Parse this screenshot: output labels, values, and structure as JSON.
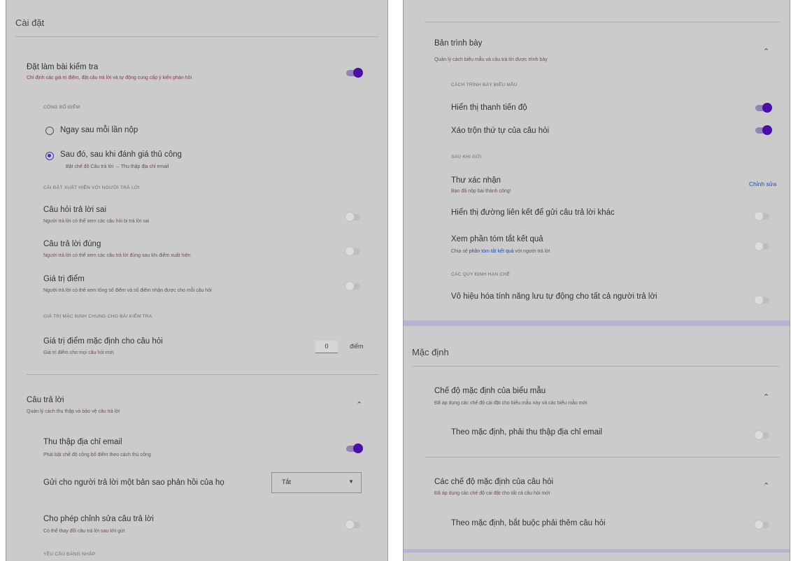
{
  "left": {
    "title": "Cài đặt",
    "quiz": {
      "label": "Đặt làm bài kiểm tra",
      "desc": "Chỉ định các giá trị điểm, đặt câu trả lời và tự động cung cấp ý kiến phản hồi",
      "toggle": true
    },
    "release_caption": "CÔNG BỐ ĐIỂM",
    "release_options": [
      {
        "label": "Ngay sau mỗi lần nộp",
        "selected": false
      },
      {
        "label": "Sau đó, sau khi đánh giá thủ công",
        "selected": true,
        "sub": "Bật chế độ Câu trả lời → Thu thập địa chỉ email"
      }
    ],
    "see_caption": "CÀI ĐẶT XUẤT HIỆN VỚI NGƯỜI TRẢ LỜI",
    "see_items": [
      {
        "label": "Câu hỏi trả lời sai",
        "desc": "Người trả lời có thể xem các câu hỏi bị trả lời sai",
        "toggle": false
      },
      {
        "label": "Câu trả lời đúng",
        "desc": "Người trả lời có thể xem các câu trả lời đúng sau khi điểm xuất hiện",
        "toggle": false
      },
      {
        "label": "Giá trị điểm",
        "desc": "Người trả lời có thể xem tổng số điểm và số điểm nhận được cho mỗi câu hỏi",
        "toggle": false
      }
    ],
    "default_caption": "GIÁ TRỊ MẶC ĐỊNH CHUNG CHO BÀI KIỂM TRA",
    "default_points": {
      "label": "Giá trị điểm mặc định cho câu hỏi",
      "desc": "Giá trị điểm cho mọi câu hỏi mới",
      "value": "0",
      "unit": "điểm"
    },
    "responses": {
      "label": "Câu trả lời",
      "desc": "Quản lý cách thu thập và bảo vệ câu trả lời",
      "chevron": "⌃"
    },
    "collect_email": {
      "label": "Thu thập địa chỉ email",
      "desc": "Phải bật chế độ công bố điểm theo cách thủ công",
      "toggle": true
    },
    "send_copy": {
      "label": "Gửi cho người trả lời một bản sao phản hồi của họ",
      "select_value": "Tắt",
      "arrow": "▼"
    },
    "allow_edit": {
      "label": "Cho phép chỉnh sửa câu trả lời",
      "desc": "Có thể thay đổi câu trả lời sau khi gửi",
      "toggle": false
    },
    "login_caption": "YÊU CẦU ĐĂNG NHẬP"
  },
  "right": {
    "presentation": {
      "label": "Bản trình bày",
      "desc": "Quản lý cách biểu mẫu và câu trả lời được trình bày",
      "chevron": "⌃"
    },
    "form_caption": "CÁCH TRÌNH BÀY BIỂU MẪU",
    "form_items": [
      {
        "label": "Hiển thị thanh tiến độ",
        "toggle": true
      },
      {
        "label": "Xáo trộn thứ tự của câu hỏi",
        "toggle": true
      }
    ],
    "after_caption": "SAU KHI GỬI",
    "confirm": {
      "label": "Thư xác nhận",
      "desc": "Bạn đã nộp bài thành công!",
      "action": "Chỉnh sửa"
    },
    "show_link": {
      "label": "Hiển thị đường liên kết để gửi câu trả lời khác",
      "toggle": false
    },
    "view_results": {
      "label": "Xem phần tóm tắt kết quả",
      "desc_prefix": "Chia sẻ ",
      "desc_link": "phần tóm tắt kết quả",
      "desc_suffix": " với người trả lời",
      "toggle": false
    },
    "restrict_caption": "CÁC QUY ĐỊNH HẠN CHẾ",
    "autosave": {
      "label": "Vô hiệu hóa tính năng lưu tự động cho tất cả người trả lời",
      "toggle": false
    },
    "defaults_title": "Mặc định",
    "form_defaults": {
      "label": "Chế độ mặc định của biểu mẫu",
      "desc": "Đã áp dụng các chế độ cài đặt cho biểu mẫu này và các biểu mẫu mới",
      "chevron": "⌃"
    },
    "collect_email_default": {
      "label": "Theo mặc định, phải thu thập địa chỉ email",
      "toggle": false
    },
    "question_defaults": {
      "label": "Các chế độ mặc định của câu hỏi",
      "desc": "Đã áp dụng các chế độ cài đặt cho tất cả câu hỏi mới",
      "chevron": "⌃"
    },
    "required_default": {
      "label": "Theo mặc định, bắt buộc phải thêm câu hỏi",
      "toggle": false
    }
  },
  "colors": {
    "accent": "#4a0fa8",
    "background": "#cbcbcb",
    "link": "#1a4dbb"
  }
}
